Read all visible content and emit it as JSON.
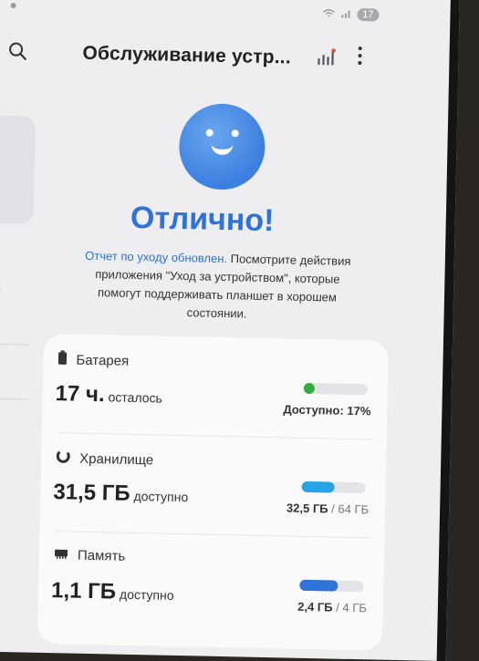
{
  "status_bar": {
    "battery": "17"
  },
  "header": {
    "title": "Обслуживание устр..."
  },
  "side": {
    "partial_label": "ки"
  },
  "hero": {
    "title": "Отлично!",
    "desc_link": "Отчет по уходу обновлен.",
    "desc_text": " Посмотрите действия приложения \"Уход за устройством\", которые помогут поддерживать планшет в хорошем состоянии."
  },
  "battery": {
    "label": "Батарея",
    "value": "17 ч.",
    "unit": "осталось",
    "status": "Доступно: 17%",
    "level": 0.17,
    "color": "#2fae3c"
  },
  "storage": {
    "label": "Хранилище",
    "value": "31,5 ГБ",
    "unit": "доступно",
    "used": "32,5 ГБ",
    "sep": " / ",
    "total": "64 ГБ",
    "level": 0.51,
    "color": "#27a4e8"
  },
  "memory": {
    "label": "Память",
    "value": "1,1 ГБ",
    "unit": "доступно",
    "used": "2,4 ГБ",
    "sep": " / ",
    "total": "4 ГБ",
    "level": 0.6,
    "color": "#2f72d8"
  }
}
